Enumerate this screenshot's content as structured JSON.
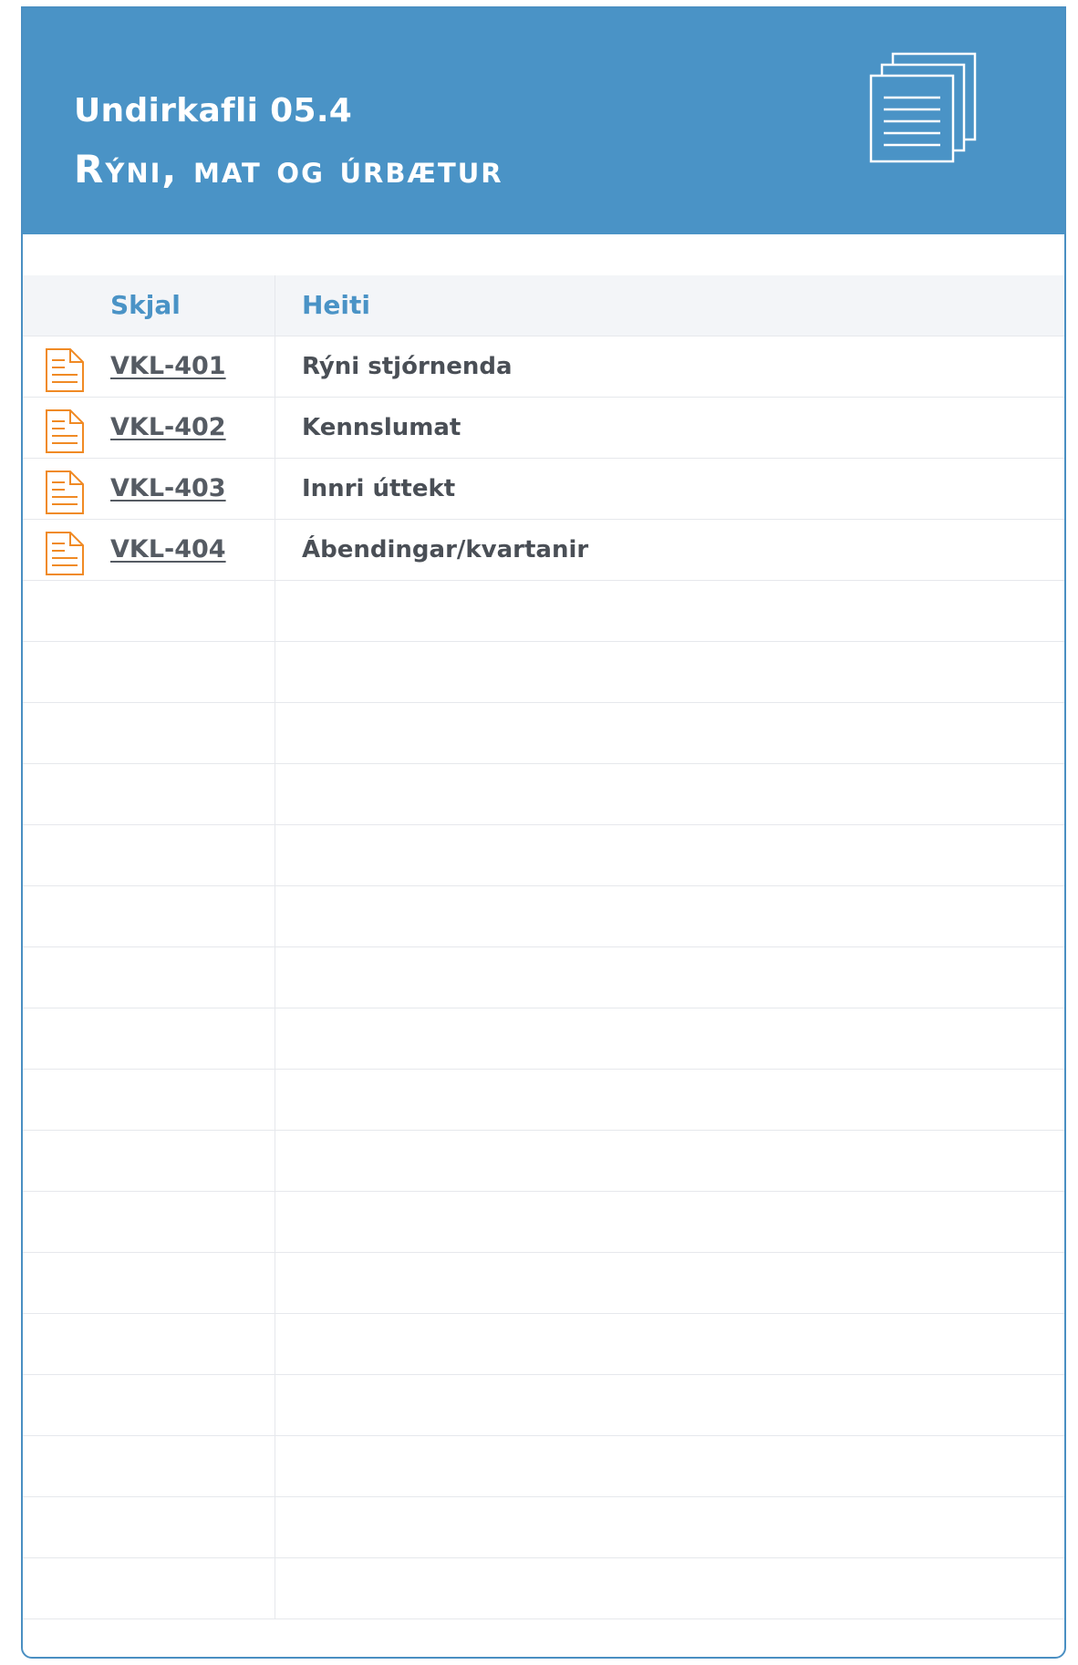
{
  "header": {
    "subtitle": "Undirkafli 05.4",
    "title": "Rýni, mat og úrbætur",
    "icon": "document-stack-icon"
  },
  "colors": {
    "header_bg": "#4a93c6",
    "accent": "#4a93c6",
    "file_icon": "#f08a24"
  },
  "table": {
    "columns": [
      "Skjal",
      "Heiti"
    ],
    "rows": [
      {
        "code": "VKL-401",
        "name": "Rýni stjórnenda",
        "icon": "document-icon"
      },
      {
        "code": "VKL-402",
        "name": "Kennslumat",
        "icon": "document-icon"
      },
      {
        "code": "VKL-403",
        "name": "Innri úttekt",
        "icon": "document-icon"
      },
      {
        "code": "VKL-404",
        "name": "Ábendingar/kvartanir",
        "icon": "document-icon"
      }
    ]
  }
}
